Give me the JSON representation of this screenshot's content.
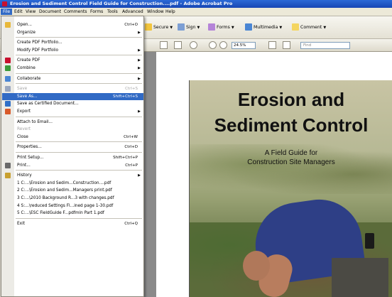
{
  "window": {
    "title": "Erosion and Sediment Control Field Guide for Construction....pdf - Adobe Acrobat Pro"
  },
  "menubar": [
    "File",
    "Edit",
    "View",
    "Document",
    "Comments",
    "Forms",
    "Tools",
    "Advanced",
    "Window",
    "Help"
  ],
  "toolbar": {
    "secure": "Secure",
    "sign": "Sign",
    "forms": "Forms",
    "multimedia": "Multimedia",
    "comment": "Comment",
    "zoom": "24.5%",
    "find_placeholder": "Find"
  },
  "file_menu": [
    {
      "label": "Open...",
      "shortcut": "Ctrl+O",
      "icon": "open-folder-icon"
    },
    {
      "label": "Organize",
      "arrow": true
    },
    {
      "sep": true
    },
    {
      "label": "Create PDF Portfolio..."
    },
    {
      "label": "Modify PDF Portfolio",
      "arrow": true
    },
    {
      "sep": true
    },
    {
      "label": "Create PDF",
      "arrow": true,
      "icon": "create-pdf-icon"
    },
    {
      "label": "Combine",
      "arrow": true,
      "icon": "combine-icon"
    },
    {
      "sep": true
    },
    {
      "label": "Collaborate",
      "arrow": true,
      "icon": "collaborate-icon"
    },
    {
      "sep": true
    },
    {
      "label": "Save",
      "shortcut": "Ctrl+S",
      "disabled": true,
      "icon": "save-icon"
    },
    {
      "label": "Save As...",
      "shortcut": "Shift+Ctrl+S",
      "selected": true
    },
    {
      "label": "Save as Certified Document...",
      "icon": "certified-icon"
    },
    {
      "label": "Export",
      "arrow": true,
      "icon": "export-icon"
    },
    {
      "sep": true
    },
    {
      "label": "Attach to Email..."
    },
    {
      "label": "Revert",
      "disabled": true
    },
    {
      "label": "Close",
      "shortcut": "Ctrl+W"
    },
    {
      "sep": true
    },
    {
      "label": "Properties...",
      "shortcut": "Ctrl+D"
    },
    {
      "sep": true
    },
    {
      "label": "Print Setup...",
      "shortcut": "Shift+Ctrl+P"
    },
    {
      "label": "Print...",
      "shortcut": "Ctrl+P",
      "icon": "print-icon"
    },
    {
      "sep": true
    },
    {
      "label": "History",
      "arrow": true,
      "icon": "history-icon"
    },
    {
      "label": "1 C:...\\Erosion and Sedim...Construction....pdf"
    },
    {
      "label": "2 C:...\\Erosion and Sedim...Managers print.pdf"
    },
    {
      "label": "3 C:...\\2010 Background R...3 with changes.pdf"
    },
    {
      "label": "4 S:...\\reduced Settings Fl...ined page 1-30.pdf"
    },
    {
      "label": "5 C:...\\ESC FieldGuide F...pdfmin Part 1.pdf"
    },
    {
      "sep": true
    },
    {
      "label": "Exit",
      "shortcut": "Ctrl+Q"
    }
  ],
  "cover": {
    "title_line1": "Erosion and",
    "title_line2": "Sediment Control",
    "subtitle_line1": "A Field Guide for",
    "subtitle_line2": "Construction Site Managers"
  },
  "colors": {
    "titlebar": "#1f4fbf",
    "menu_highlight": "#316ac5",
    "person_shirt": "#2e3f86"
  }
}
